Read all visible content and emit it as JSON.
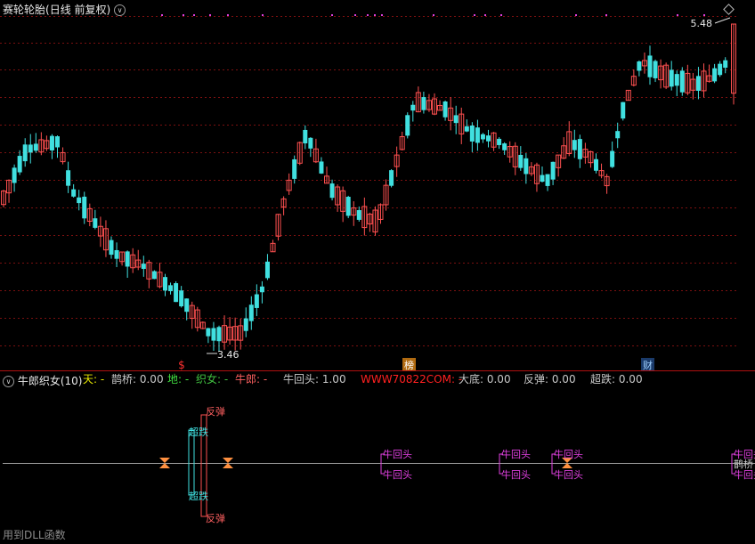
{
  "main_panel": {
    "title": "赛轮轮胎",
    "period": "(日线 前复权)",
    "high_label": "5.48",
    "low_label": "3.46",
    "markers": [
      {
        "label": "$",
        "color": "#ff3030"
      },
      {
        "label": "榜",
        "color": "#ffffff",
        "bg": "#b06a10"
      },
      {
        "label": "财",
        "color": "#9fd0ff",
        "bg": "#1a3a6a"
      }
    ]
  },
  "indicator_panel": {
    "title": "牛郎织女(10)",
    "fields": [
      {
        "label": "天: -",
        "color": "#e8e800"
      },
      {
        "label": "鹊桥: 0.00",
        "color": "#c8c8c8"
      },
      {
        "label": "地: -",
        "color": "#40e040"
      },
      {
        "label": "织女: -",
        "color": "#40c040"
      },
      {
        "label": "牛郎: -",
        "color": "#ff6060"
      },
      {
        "label": "牛回头: 1.00",
        "color": "#c8c8c8"
      },
      {
        "label": "WWW70822COM: -",
        "color": "#ff2020"
      },
      {
        "label": "大底: 0.00",
        "color": "#c8c8c8"
      },
      {
        "label": "反弹: 0.00",
        "color": "#c8c8c8"
      },
      {
        "label": "超跌: 0.00",
        "color": "#c8c8c8"
      }
    ],
    "signals": {
      "rebound": "反弹",
      "oversold": "超跌",
      "bull_turn": "牛回头",
      "bridge": "鹊桥"
    }
  },
  "footer": {
    "text": "用到DLL函数"
  },
  "colors": {
    "up": "#ff5050",
    "down": "#40e0e0",
    "grid": "#7a1010",
    "signal": "#e040e0",
    "dot": "#e040e0"
  },
  "chart_data": {
    "type": "candlestick",
    "range": [
      3.46,
      5.48
    ],
    "candles": []
  }
}
